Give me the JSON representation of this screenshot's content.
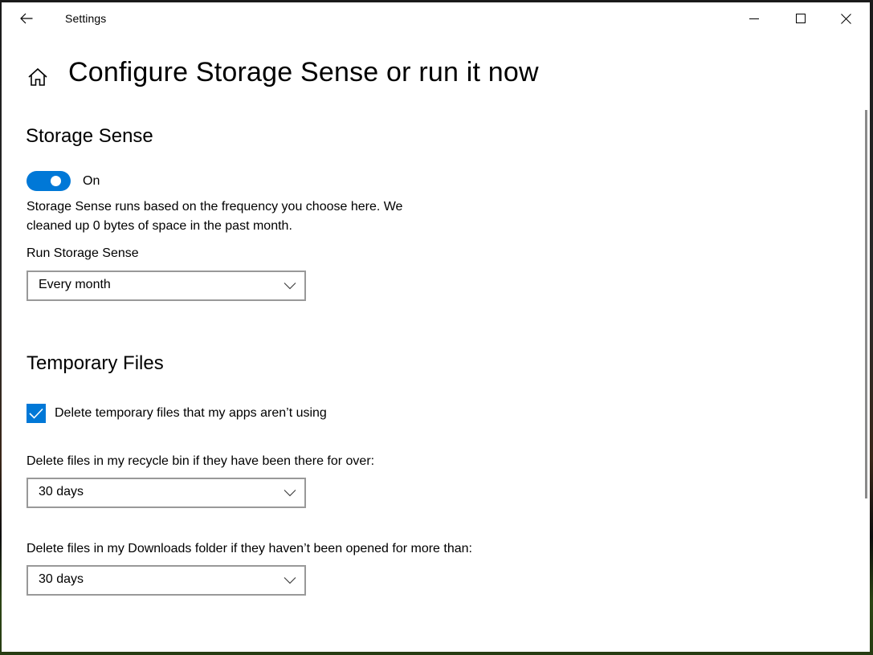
{
  "window": {
    "app_title": "Settings",
    "back_icon": "arrow-left-icon",
    "minimize_icon": "minimize-icon",
    "maximize_icon": "maximize-icon",
    "close_icon": "close-icon"
  },
  "header": {
    "home_icon": "home-icon",
    "title": "Configure Storage Sense or run it now"
  },
  "storage_sense": {
    "section_title": "Storage Sense",
    "toggle_state": "on",
    "toggle_label": "On",
    "description_line1": "Storage Sense runs based on the frequency you choose here. We",
    "description_line2": "cleaned up 0 bytes of space in the past month.",
    "run_label": "Run Storage Sense",
    "run_value": "Every month"
  },
  "temporary_files": {
    "section_title": "Temporary Files",
    "checkbox_checked": true,
    "checkbox_label": "Delete temporary files that my apps aren’t using",
    "recycle_bin_label": "Delete files in my recycle bin if they have been there for over:",
    "recycle_bin_value": "30 days",
    "downloads_label": "Delete files in my Downloads folder if they haven’t been opened for more than:",
    "downloads_value": "30 days"
  },
  "colors": {
    "accent": "#0078d7",
    "combo_border": "#999999",
    "scrollbar": "#8a8a8a"
  }
}
